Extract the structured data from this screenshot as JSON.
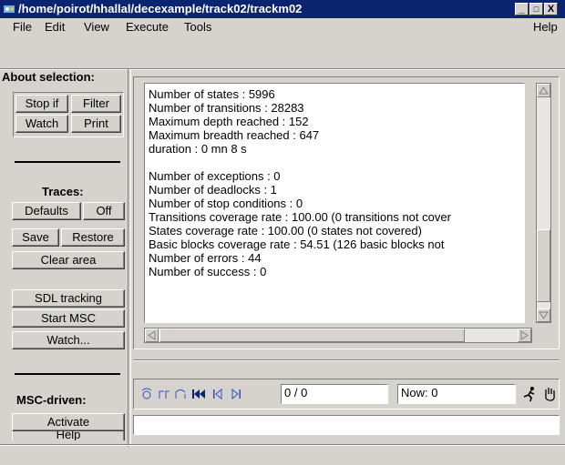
{
  "window": {
    "title": "/home/poirot/hhallal/decexample/track02/trackm02",
    "controls": [
      "_",
      "□",
      "X"
    ]
  },
  "menu": {
    "file": "File",
    "edit": "Edit",
    "view": "View",
    "execute": "Execute",
    "tools": "Tools",
    "help": "Help"
  },
  "sidebar": {
    "about_selection": "About selection:",
    "stop_if": "Stop if",
    "filter": "Filter",
    "watch": "Watch",
    "print": "Print",
    "traces": "Traces:",
    "defaults": "Defaults",
    "off": "Off",
    "save": "Save",
    "restore": "Restore",
    "clear_area": "Clear area",
    "sdl_tracking": "SDL tracking",
    "start_msc": "Start MSC",
    "watch_dots": "Watch...",
    "msc_driven": "MSC-driven:",
    "activate": "Activate",
    "help": "Help"
  },
  "output": {
    "lines": [
      "Number of states : 5996",
      "Number of transitions : 28283",
      "Maximum depth reached : 152",
      "Maximum breadth reached : 647",
      "duration : 0 mn 8 s",
      "",
      "Number of exceptions : 0",
      "Number of deadlocks : 1",
      "Number of stop conditions : 0",
      "Transitions coverage rate : 100.00 (0 transitions not cover",
      "States coverage rate : 100.00 (0 states not covered)",
      "Basic blocks coverage rate : 54.51 (126 basic blocks not",
      "Number of errors : 44",
      "Number of success : 0"
    ]
  },
  "trace_nav": {
    "position": "0 / 0",
    "now": "Now: 0",
    "icons": [
      "step-into-icon",
      "step-over-icon",
      "step-out-icon",
      "first-icon",
      "previous-icon",
      "next-icon",
      "run-icon",
      "stop-hand-icon"
    ]
  },
  "input": {
    "value": ""
  }
}
